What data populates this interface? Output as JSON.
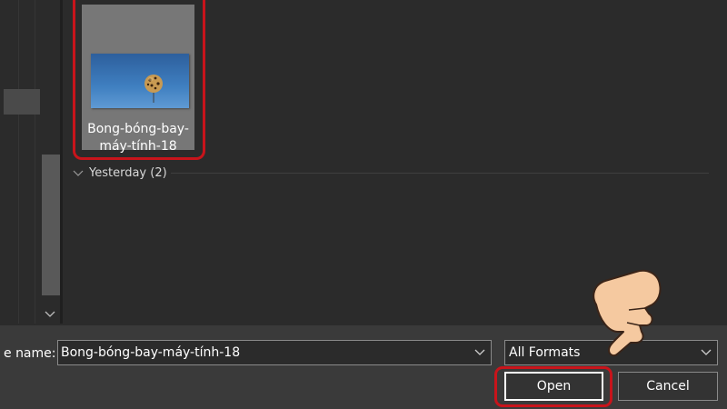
{
  "file_list": {
    "items": [
      {
        "name": "Bong-bóng-bay-máy-tính-18",
        "thumbnail_icon": "balloon-image-thumbnail"
      }
    ],
    "groups": [
      {
        "label": "Yesterday (2)"
      }
    ]
  },
  "footer": {
    "filename_label": "e name:",
    "filename_value": "Bong-bóng-bay-máy-tính-18",
    "format_value": "All Formats",
    "open_label": "Open",
    "cancel_label": "Cancel"
  },
  "colors": {
    "highlight": "#c8141b",
    "background": "#2b2b2b",
    "bottom_bar": "#3a3a3a",
    "selected_tile": "#777777"
  }
}
